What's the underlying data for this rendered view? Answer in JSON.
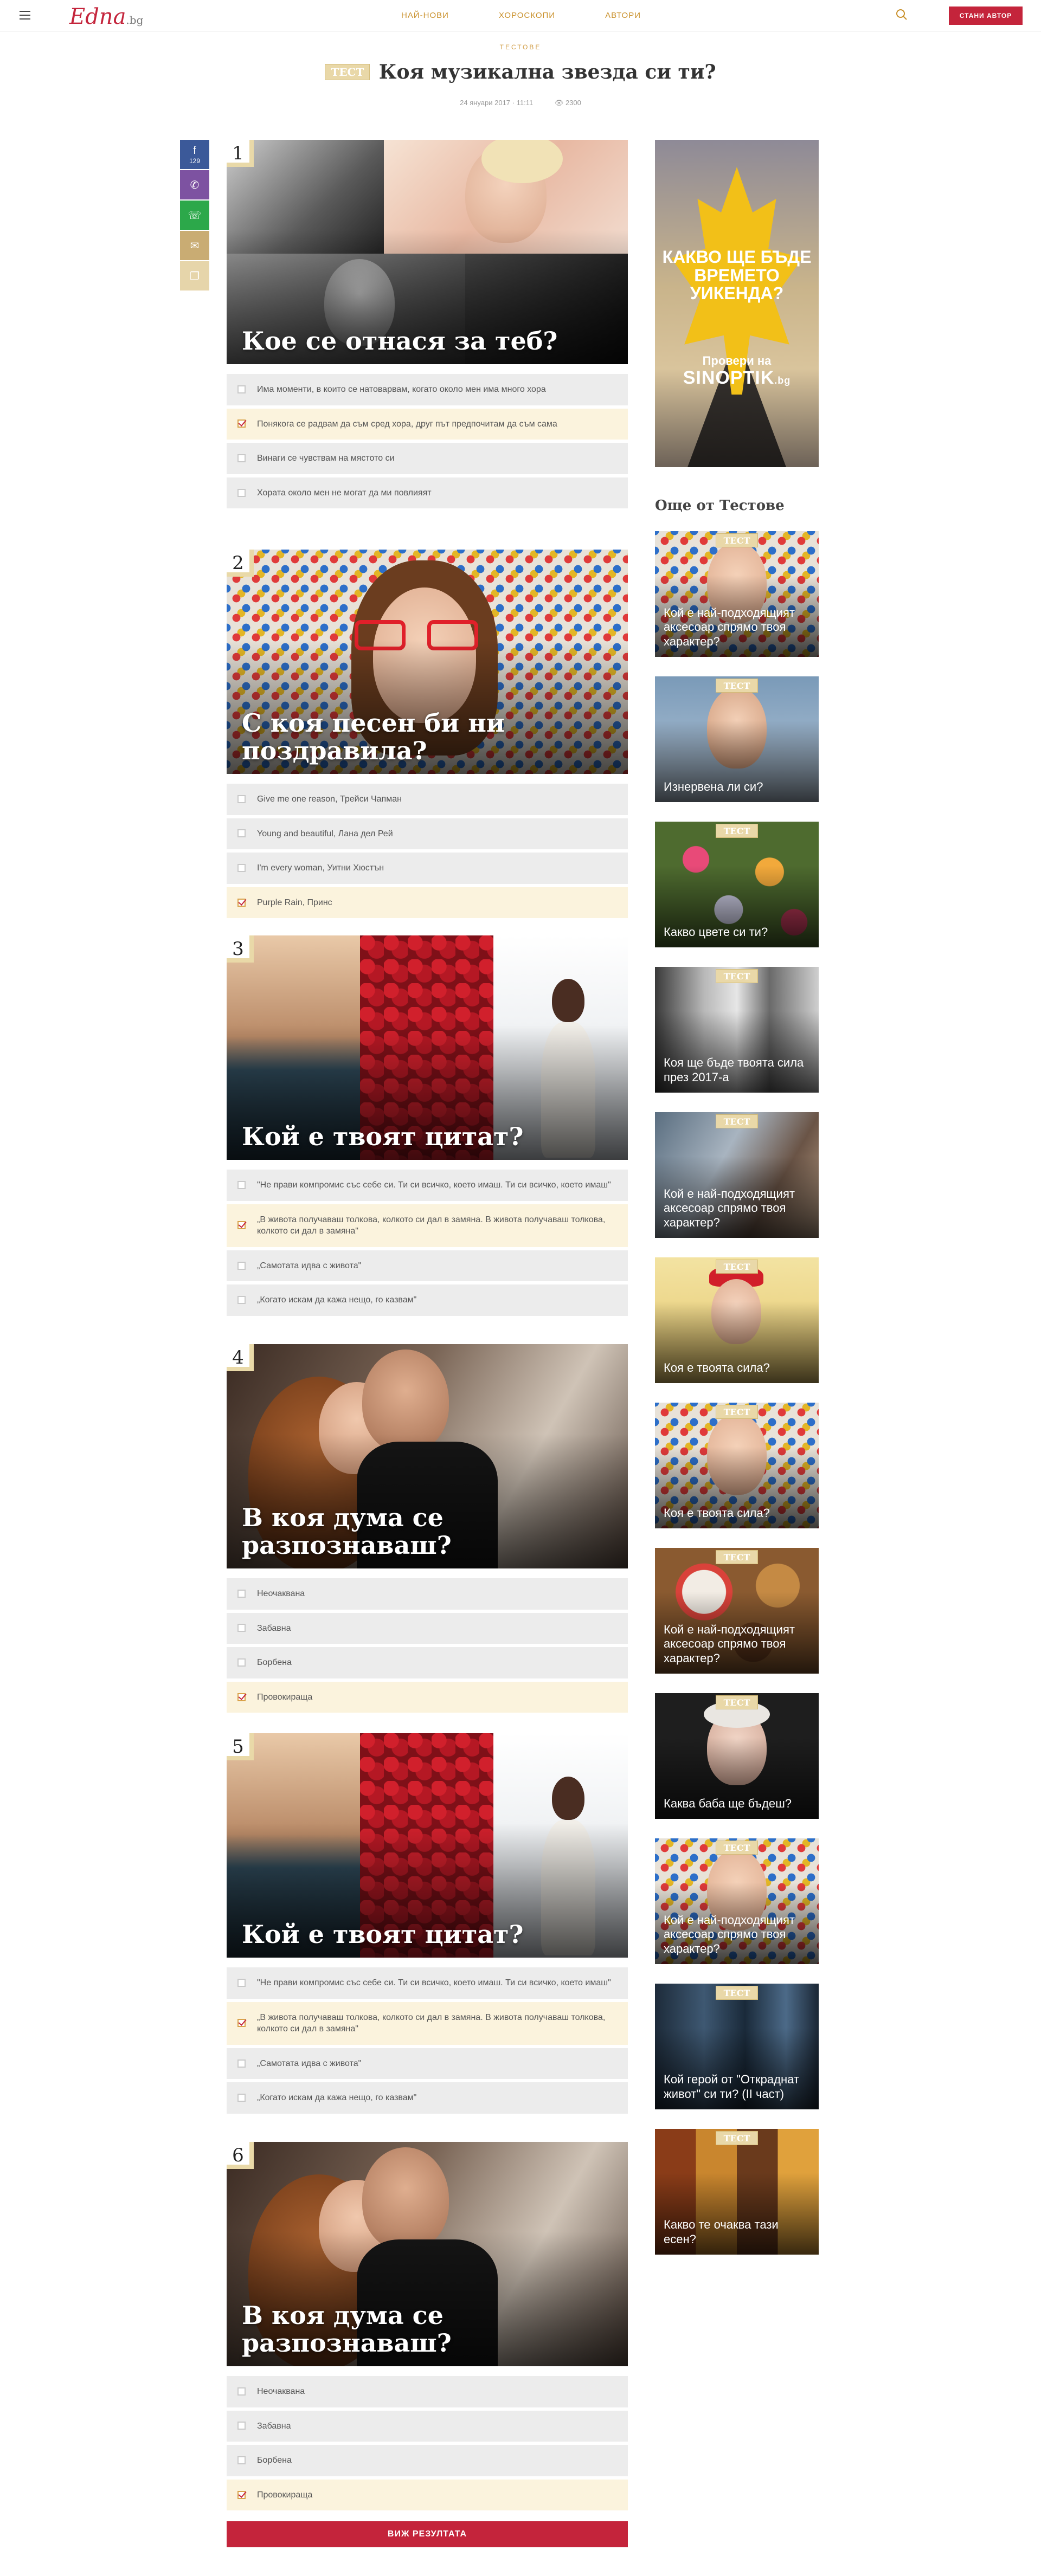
{
  "header": {
    "logo_main": "Edna",
    "logo_suffix": ".bg",
    "nav": [
      "НАЙ-НОВИ",
      "ХОРОСКОПИ",
      "АВТОРИ"
    ],
    "become_author": "СТАНИ АВТОР"
  },
  "article": {
    "section": "ТЕСТОВЕ",
    "badge": "ТЕСТ",
    "title": "Коя музикална звезда си ти?",
    "date": "24 януари 2017 · 11:11",
    "views": "2300"
  },
  "share": {
    "fb_count": "129"
  },
  "questions": [
    {
      "num": "1",
      "title": "Кое се отнася за теб?",
      "answers": [
        {
          "text": "Има моменти, в които се натоварвам, когато около мен има много хора",
          "selected": false
        },
        {
          "text": "Понякога се радвам да съм сред хора, друг път предпочитам да съм сама",
          "selected": true
        },
        {
          "text": "Винаги се чувствам на мястото си",
          "selected": false
        },
        {
          "text": "Хората около мен не могат да ми повлияят",
          "selected": false
        }
      ]
    },
    {
      "num": "2",
      "title": "С коя песен би ни поздравила?",
      "answers": [
        {
          "text": "Give me one reason, Трейси Чапман",
          "selected": false
        },
        {
          "text": "Young and beautiful, Лана дел Рей",
          "selected": false
        },
        {
          "text": "I'm every woman, Уитни Хюстън",
          "selected": false
        },
        {
          "text": "Purple Rain, Принс",
          "selected": true
        }
      ]
    },
    {
      "num": "3",
      "title": "Кой е твоят цитат?",
      "answers": [
        {
          "text": "\"Не прави компромис със себе си. Ти си всичко, което имаш. Ти си всичко, което имаш\"",
          "selected": false
        },
        {
          "text": "„В живота получаваш толкова, колкото си дал в замяна. В живота получаваш толкова, колкото си дал в замяна\"",
          "selected": true
        },
        {
          "text": "„Самотата идва с живота\"",
          "selected": false
        },
        {
          "text": "„Когато искам да кажа нещо, го казвам\"",
          "selected": false
        }
      ]
    },
    {
      "num": "4",
      "title": "В коя дума се разпознаваш?",
      "answers": [
        {
          "text": "Неочаквана",
          "selected": false
        },
        {
          "text": "Забавна",
          "selected": false
        },
        {
          "text": "Борбена",
          "selected": false
        },
        {
          "text": "Провокираща",
          "selected": true
        }
      ]
    },
    {
      "num": "5",
      "title": "Кой е твоят цитат?",
      "answers": [
        {
          "text": "\"Не прави компромис със себе си. Ти си всичко, което имаш. Ти си всичко, което имаш\"",
          "selected": false
        },
        {
          "text": "„В живота получаваш толкова, колкото си дал в замяна. В живота получаваш толкова, колкото си дал в замяна\"",
          "selected": true
        },
        {
          "text": "„Самотата идва с живота\"",
          "selected": false
        },
        {
          "text": "„Когато искам да кажа нещо, го казвам\"",
          "selected": false
        }
      ]
    },
    {
      "num": "6",
      "title": "В коя дума се разпознаваш?",
      "answers": [
        {
          "text": "Неочаквана",
          "selected": false
        },
        {
          "text": "Забавна",
          "selected": false
        },
        {
          "text": "Борбена",
          "selected": false
        },
        {
          "text": "Провокираща",
          "selected": true
        }
      ]
    }
  ],
  "result_button": "ВИЖ РЕЗУЛТАТА",
  "ad": {
    "line1": "КАКВО ЩЕ БЪДЕ ВРЕМЕТО УИКЕНДА?",
    "line2": "Провери на",
    "brand": "SINOPTIK",
    "brand_suffix": ".bg"
  },
  "sidebar": {
    "title": "Още от Тестове",
    "cards": [
      {
        "title": "Кой е най-подходящият аксесоар спрямо твоя характер?",
        "badge": "ТЕСТ"
      },
      {
        "title": "Изнервена ли си?",
        "badge": "ТЕСТ"
      },
      {
        "title": "Какво цвете си ти?",
        "badge": "ТЕСТ"
      },
      {
        "title": "Коя ще бъде твоята сила през 2017-а",
        "badge": "ТЕСТ"
      },
      {
        "title": "Кой е най-подходящият аксесоар спрямо твоя характер?",
        "badge": "ТЕСТ"
      },
      {
        "title": "Коя е твоята сила?",
        "badge": "ТЕСТ"
      },
      {
        "title": "Коя е твоята сила?",
        "badge": "ТЕСТ"
      },
      {
        "title": "Кой е най-подходящият аксесоар спрямо твоя характер?",
        "badge": "ТЕСТ"
      },
      {
        "title": "Каква баба ще бъдеш?",
        "badge": "ТЕСТ"
      },
      {
        "title": "Кой е най-подходящият аксесоар спрямо твоя характер?",
        "badge": "ТЕСТ"
      },
      {
        "title": "Кой герой от \"Откраднат живот\" си ти? (II част)",
        "badge": "ТЕСТ"
      },
      {
        "title": "Какво те очаква тази есен?",
        "badge": "ТЕСТ"
      }
    ]
  },
  "colors": {
    "brand_red": "#c4243b",
    "gold": "#c9902a"
  }
}
